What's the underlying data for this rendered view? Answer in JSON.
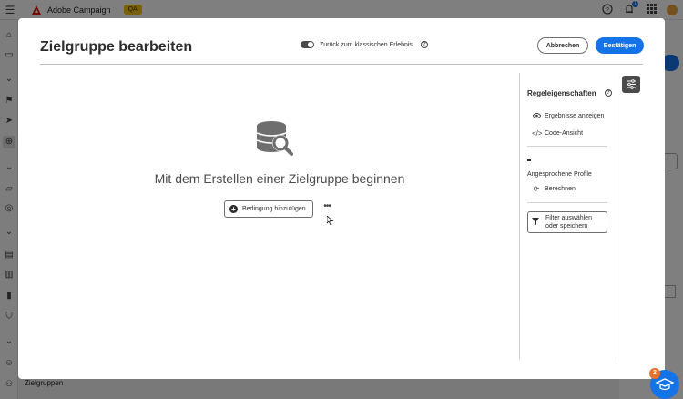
{
  "topbar": {
    "app_name": "Adobe Campaign",
    "environment_badge": "QA",
    "notification_count": "1",
    "icons": [
      "menu-icon",
      "adobe-logo-icon",
      "help-icon",
      "bell-icon",
      "apps-grid-icon",
      "avatar"
    ]
  },
  "leftrail": {
    "bottom_label": "Zielgruppen",
    "icons": [
      "home-icon",
      "folder-icon",
      "chevron-icon",
      "campaign-icon",
      "send-icon",
      "audience-icon",
      "chevron-icon",
      "content-icon",
      "offer-icon",
      "chevron-icon",
      "report-icon",
      "catalog-icon",
      "chart-icon",
      "shield-icon",
      "chevron-icon",
      "profile-icon",
      "audiences-icon"
    ]
  },
  "modal": {
    "title": "Zielgruppe bearbeiten",
    "toggle_label": "Zurück zum klassischen Erlebnis",
    "toggle_on": true,
    "cancel_label": "Abbrechen",
    "confirm_label": "Bestätigen"
  },
  "canvas": {
    "empty_message": "Mit dem Erstellen einer Zielgruppe beginnen",
    "add_condition_label": "Bedingung hinzufügen",
    "more_label": "•••"
  },
  "rules_panel": {
    "title": "Regeleigenschaften",
    "show_results_label": "Ergebnisse anzeigen",
    "code_view_label": "Code-Ansicht",
    "profiles_value": "-",
    "profiles_label": "Angesprochene Profile",
    "calculate_label": "Berechnen",
    "filter_label_line1": "Filter auswählen",
    "filter_label_line2": "oder speichern"
  },
  "help_fab": {
    "count": "2"
  },
  "colors": {
    "accent": "#1473e6",
    "environment_badge": "#f3c000",
    "badge_orange": "#e8702a",
    "dark_button": "#4b4b4b"
  }
}
